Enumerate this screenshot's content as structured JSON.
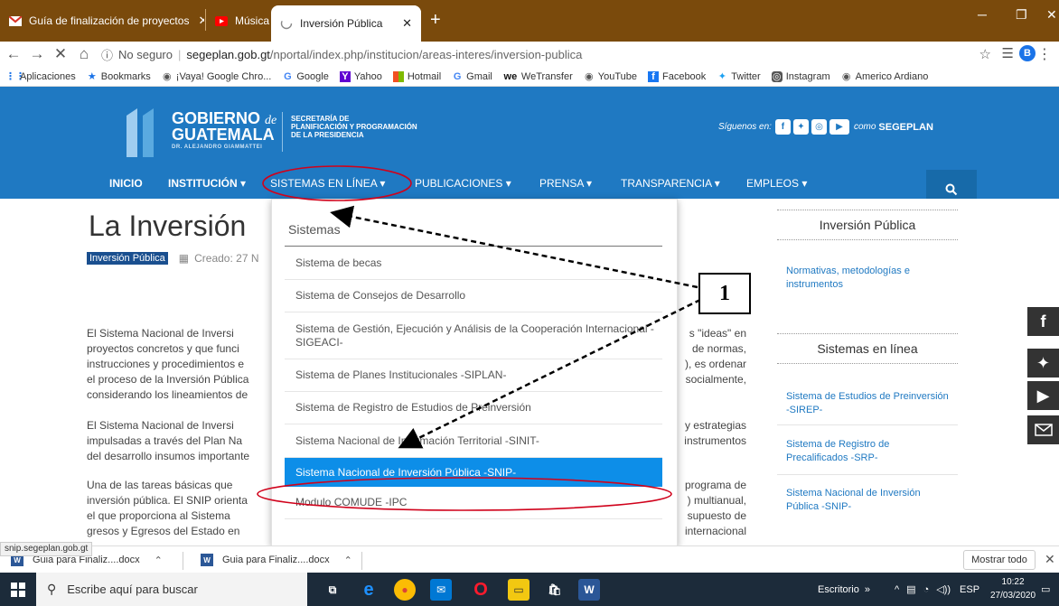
{
  "browser": {
    "tabs": [
      {
        "title": "Guía de finalización de proyectos",
        "favicon": "gmail-icon"
      },
      {
        "title": "Música Electrónica para Trab",
        "favicon": "youtube-icon"
      },
      {
        "title": "Inversión Pública",
        "favicon": "loading-icon"
      }
    ],
    "url": {
      "security": "No seguro",
      "host": "segeplan.gob.gt",
      "path": "/nportal/index.php/institucion/areas-interes/inversion-publica"
    },
    "profile_initial": "B",
    "bookmarks": [
      "Aplicaciones",
      "Bookmarks",
      "¡Vaya! Google Chro...",
      "Google",
      "Yahoo",
      "Hotmail",
      "Gmail",
      "WeTransfer",
      "YouTube",
      "Facebook",
      "Twitter",
      "Instagram",
      "Americo Ardiano"
    ]
  },
  "header": {
    "gob_line1": "GOBIERNO",
    "gob_de": "de",
    "gob_line2": "GUATEMALA",
    "gob_line3": "DR. ALEJANDRO GIAMMATTEI",
    "secretaria_line1": "SECRETARÍA DE",
    "secretaria_line2": "PLANIFICACIÓN Y PROGRAMACIÓN",
    "secretaria_line3": "DE LA PRESIDENCIA",
    "follow_label": "Síguenos en:",
    "como_label": "como",
    "seg_label": "SEGEPLAN"
  },
  "nav": {
    "items": [
      "INICIO",
      "INSTITUCIÓN ▾",
      "SISTEMAS EN LÍNEA ▾",
      "PUBLICACIONES ▾",
      "PRENSA ▾",
      "TRANSPARENCIA ▾",
      "EMPLEOS ▾"
    ]
  },
  "article": {
    "title": "La Inversión",
    "category": "Inversión Pública",
    "created": "Creado: 27 N",
    "p1": [
      "El Sistema Nacional de Inversi",
      "proyectos concretos y que funci",
      "instrucciones y procedimientos e",
      "el proceso de la Inversión Pública",
      "considerando los lineamientos de"
    ],
    "p1_right": [
      "s \"ideas\" en",
      "de normas,",
      "), es ordenar",
      "socialmente,"
    ],
    "p2": [
      "El Sistema Nacional de Inversi",
      "impulsadas a través del Plan Na",
      "del desarrollo insumos importante"
    ],
    "p2_right": [
      "y estrategias",
      "instrumentos"
    ],
    "p3": [
      "Una de las tareas básicas que",
      "inversión pública. El SNIP orienta",
      "el que proporciona al Sistema",
      "gresos y Egresos del Estado en"
    ],
    "p3_right": [
      "programa de",
      ") multianual,",
      "supuesto de",
      "internacional"
    ]
  },
  "dropdown": {
    "heading": "Sistemas",
    "items": [
      "Sistema de becas",
      "Sistema de Consejos de Desarrollo",
      "Sistema de Gestión, Ejecución y Análisis de la Cooperación Internacional -SIGEACI-",
      "Sistema de Planes Institucionales -SIPLAN-",
      "Sistema de Registro de Estudios de Preinversión",
      "Sistema Nacional de Información Territorial -SINIT-",
      "Sistema Nacional de Inversión Pública -SNIP-",
      "Modulo COMUDE -IPC"
    ],
    "active_index": 6
  },
  "sidebar": {
    "heading1": "Inversión Pública",
    "links1": [
      "Normativas, metodologías e instrumentos"
    ],
    "heading2": "Sistemas en línea",
    "links2": [
      "Sistema de Estudios de Preinversión -SIREP-",
      "Sistema de Registro de Precalificados -SRP-",
      "Sistema Nacional de Inversión Pública -SNIP-"
    ]
  },
  "annotation": {
    "label": "1",
    "color": "#d0021b"
  },
  "status_url": "snip.segeplan.gob.gt",
  "downloads": {
    "items": [
      "Guia para Finaliz....docx",
      "Guia para Finaliz....docx"
    ],
    "show_all": "Mostrar todo"
  },
  "taskbar": {
    "search_placeholder": "Escribe aquí para buscar",
    "desktop_label": "Escritorio",
    "lang": "ESP",
    "time": "10:22",
    "date": "27/03/2020"
  },
  "colors": {
    "brand_blue": "#1f79c2",
    "dropdown_active": "#0d8ee8",
    "tabbar": "#7a4a0c"
  }
}
